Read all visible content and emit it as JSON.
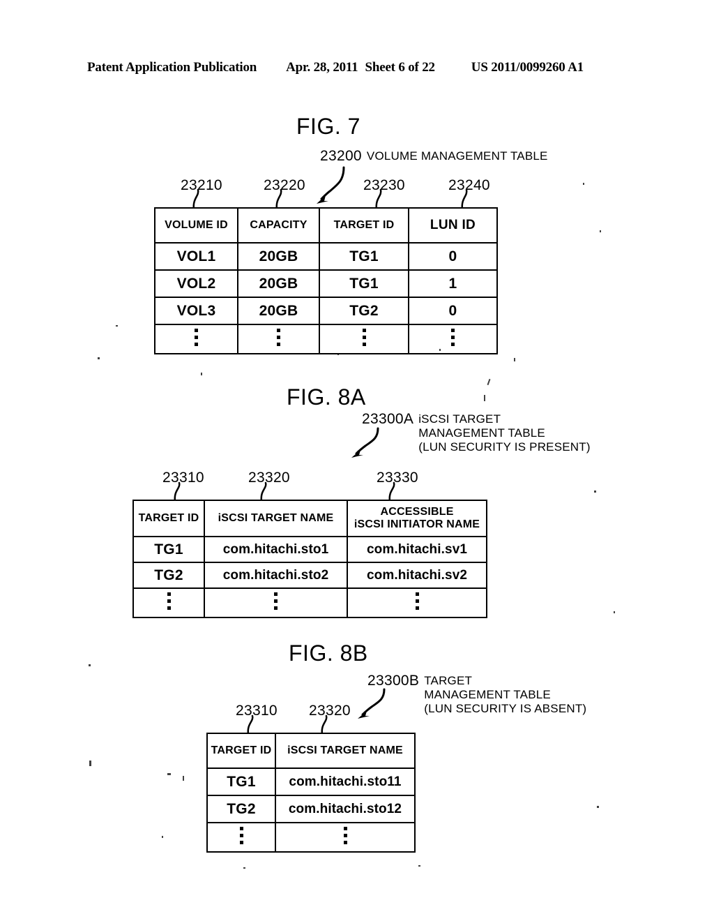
{
  "header": {
    "publication": "Patent Application Publication",
    "date": "Apr. 28, 2011",
    "sheet": "Sheet 6 of 22",
    "patent_number": "US 2011/0099260 A1"
  },
  "figures": [
    {
      "title": "FIG. 7",
      "caption_number": "23200",
      "caption_lines": [
        "VOLUME MANAGEMENT TABLE"
      ],
      "column_refs": [
        "23210",
        "23220",
        "23230",
        "23240"
      ],
      "table": {
        "headers": [
          "VOLUME ID",
          "CAPACITY",
          "TARGET ID",
          "LUN ID"
        ],
        "rows": [
          [
            "VOL1",
            "20GB",
            "TG1",
            "0"
          ],
          [
            "VOL2",
            "20GB",
            "TG1",
            "1"
          ],
          [
            "VOL3",
            "20GB",
            "TG2",
            "0"
          ]
        ],
        "ellipsis_row": true
      }
    },
    {
      "title": "FIG. 8A",
      "caption_number": "23300A",
      "caption_lines": [
        "iSCSI TARGET",
        "MANAGEMENT TABLE",
        "(LUN SECURITY IS PRESENT)"
      ],
      "column_refs": [
        "23310",
        "23320",
        "23330"
      ],
      "table": {
        "headers": [
          "TARGET ID",
          "iSCSI TARGET NAME",
          "ACCESSIBLE\niSCSI INITIATOR NAME"
        ],
        "header_line1": "ACCESSIBLE",
        "header_line2": "iSCSI INITIATOR NAME",
        "rows": [
          [
            "TG1",
            "com.hitachi.sto1",
            "com.hitachi.sv1"
          ],
          [
            "TG2",
            "com.hitachi.sto2",
            "com.hitachi.sv2"
          ]
        ],
        "ellipsis_row": true
      }
    },
    {
      "title": "FIG. 8B",
      "caption_number": "23300B",
      "caption_lines": [
        "TARGET",
        "MANAGEMENT TABLE",
        "(LUN SECURITY IS ABSENT)"
      ],
      "column_refs": [
        "23310",
        "23320"
      ],
      "table": {
        "headers": [
          "TARGET ID",
          "iSCSI TARGET NAME"
        ],
        "rows": [
          [
            "TG1",
            "com.hitachi.sto11"
          ],
          [
            "TG2",
            "com.hitachi.sto12"
          ]
        ],
        "ellipsis_row": true
      }
    }
  ],
  "colors": {
    "ink": "#000000",
    "paper": "#ffffff"
  }
}
